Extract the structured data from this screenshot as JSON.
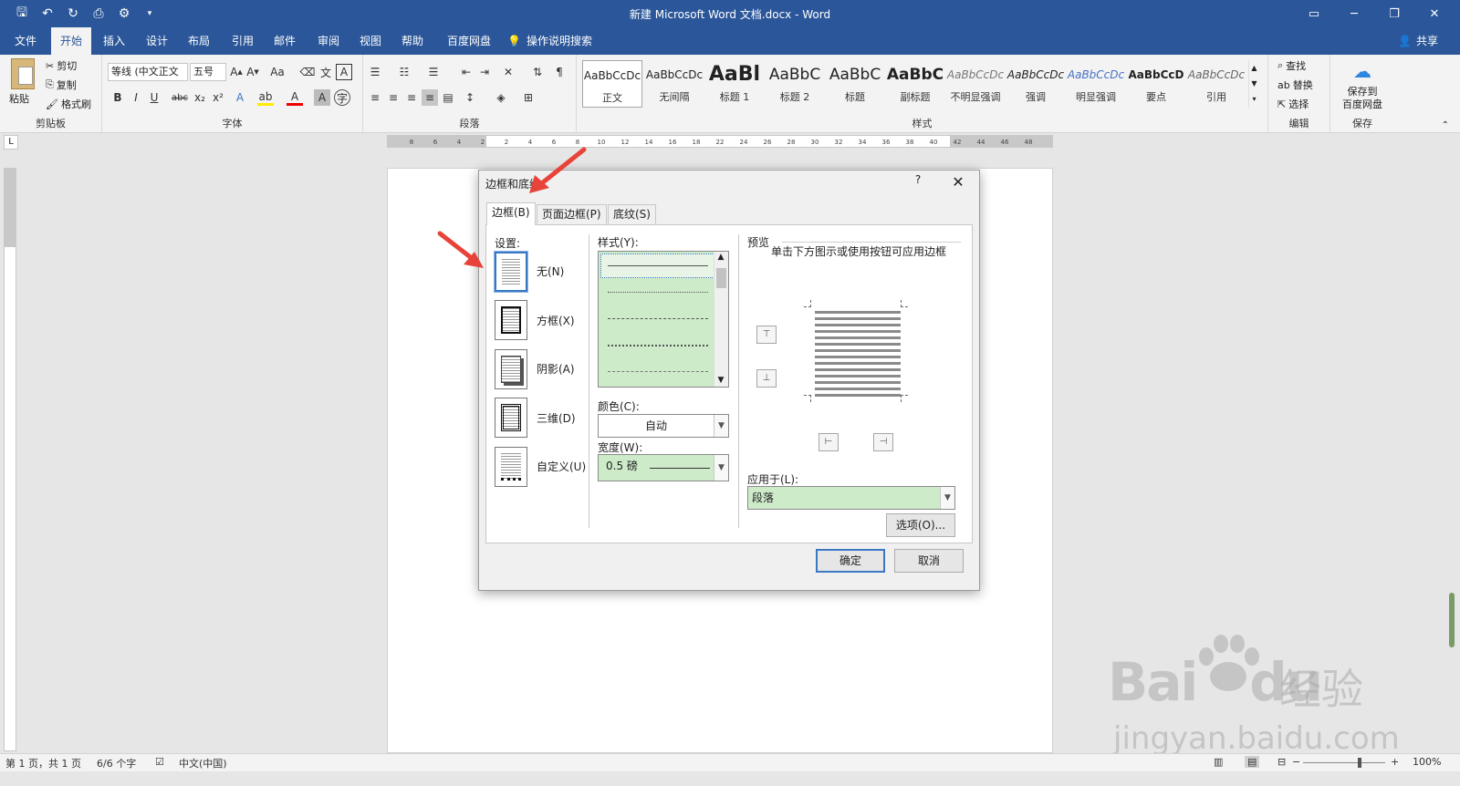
{
  "titlebar": {
    "doc_title": "新建 Microsoft Word 文档.docx  -  Word",
    "qat_icons": [
      "save-icon",
      "undo-icon",
      "redo-icon",
      "print-preview-icon",
      "customize-icon"
    ]
  },
  "menu": {
    "tabs": [
      "文件",
      "开始",
      "插入",
      "设计",
      "布局",
      "引用",
      "邮件",
      "审阅",
      "视图",
      "帮助",
      "百度网盘"
    ],
    "active_tab": "开始",
    "search_label": "操作说明搜索",
    "share_label": "共享"
  },
  "ribbon": {
    "clipboard": {
      "paste": "粘贴",
      "cut": "剪切",
      "copy": "复制",
      "format_painter": "格式刷",
      "label": "剪贴板"
    },
    "font": {
      "font_name": "等线 (中文正文",
      "font_size": "五号",
      "label": "字体"
    },
    "paragraph": {
      "label": "段落"
    },
    "styles": {
      "label": "样式",
      "items": [
        {
          "sample": "AaBbCcDc",
          "name": "正文"
        },
        {
          "sample": "AaBbCcDc",
          "name": "无间隔"
        },
        {
          "sample": "AaBl",
          "name": "标题 1"
        },
        {
          "sample": "AaBbC",
          "name": "标题 2"
        },
        {
          "sample": "AaBbC",
          "name": "标题"
        },
        {
          "sample": "AaBbC",
          "name": "副标题"
        },
        {
          "sample": "AaBbCcDc",
          "name": "不明显强调"
        },
        {
          "sample": "AaBbCcDc",
          "name": "强调"
        },
        {
          "sample": "AaBbCcDc",
          "name": "明显强调"
        },
        {
          "sample": "AaBbCcD",
          "name": "要点"
        },
        {
          "sample": "AaBbCcDc",
          "name": "引用"
        }
      ]
    },
    "editing": {
      "find": "查找",
      "replace": "替换",
      "select": "选择",
      "label": "编辑"
    },
    "save": {
      "save_to_baidu_line1": "保存到",
      "save_to_baidu_line2": "百度网盘",
      "label": "保存"
    }
  },
  "ruler": {
    "h_ticks": [
      "8",
      "6",
      "4",
      "2",
      "2",
      "4",
      "6",
      "8",
      "10",
      "12",
      "14",
      "16",
      "18",
      "22",
      "24",
      "26",
      "28",
      "30",
      "32",
      "34",
      "36",
      "38",
      "40",
      "42",
      "44",
      "46",
      "48"
    ]
  },
  "dialog": {
    "title": "边框和底纹",
    "help": "?",
    "tabs": [
      "边框(B)",
      "页面边框(P)",
      "底纹(S)"
    ],
    "settings_label": "设置:",
    "settings": [
      "无(N)",
      "方框(X)",
      "阴影(A)",
      "三维(D)",
      "自定义(U)"
    ],
    "style_label": "样式(Y):",
    "color_label": "颜色(C):",
    "color_value": "自动",
    "width_label": "宽度(W):",
    "width_value": "0.5 磅",
    "preview_label": "预览",
    "preview_hint": "单击下方图示或使用按钮可应用边框",
    "apply_to_label": "应用于(L):",
    "apply_to_value": "段落",
    "options_button": "选项(O)...",
    "ok_button": "确定",
    "cancel_button": "取消"
  },
  "status": {
    "page": "第 1 页，共 1 页",
    "words": "6/6 个字",
    "language": "中文(中国)",
    "zoom": "100%"
  },
  "watermark": {
    "brand": "Bai",
    "brand2": "du",
    "cn": "经验",
    "url": "jingyan.baidu.com"
  },
  "colors": {
    "titlebar": "#2b579a",
    "selection": "#3b78c4",
    "green_fill": "#cdebc9",
    "arrow": "#e8433a"
  }
}
